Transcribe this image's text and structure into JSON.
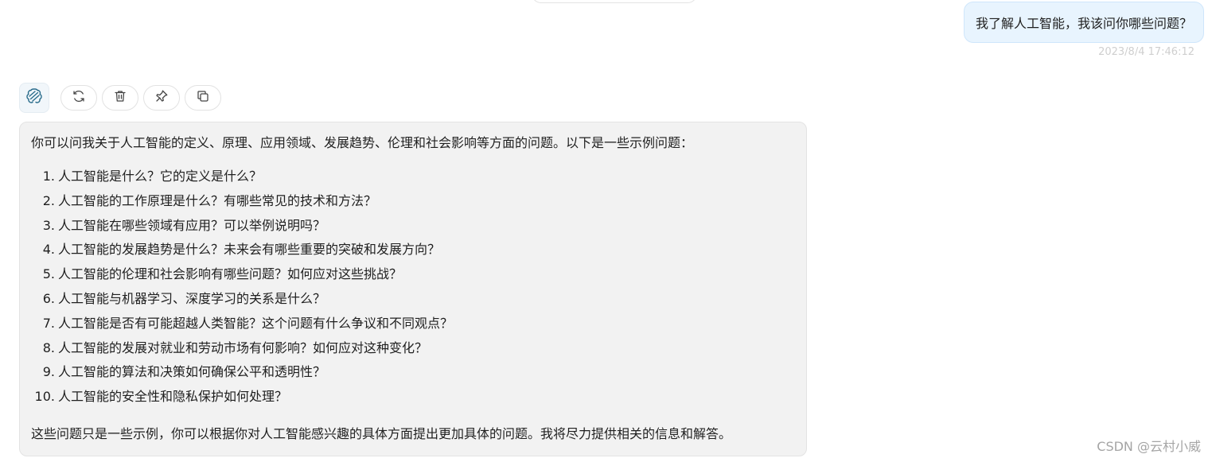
{
  "user_message": {
    "text": "我了解人工智能，我该问你哪些问题？",
    "timestamp": "2023/8/4 17:46:12"
  },
  "toolbar": {
    "icons": [
      "brain-avatar-icon",
      "refresh-icon",
      "delete-icon",
      "pin-icon",
      "copy-icon"
    ]
  },
  "bot_message": {
    "intro": "你可以问我关于人工智能的定义、原理、应用领域、发展趋势、伦理和社会影响等方面的问题。以下是一些示例问题：",
    "questions": [
      {
        "num": "1.",
        "text": "人工智能是什么？它的定义是什么？"
      },
      {
        "num": "2.",
        "text": "人工智能的工作原理是什么？有哪些常见的技术和方法？"
      },
      {
        "num": "3.",
        "text": "人工智能在哪些领域有应用？可以举例说明吗？"
      },
      {
        "num": "4.",
        "text": "人工智能的发展趋势是什么？未来会有哪些重要的突破和发展方向？"
      },
      {
        "num": "5.",
        "text": "人工智能的伦理和社会影响有哪些问题？如何应对这些挑战？"
      },
      {
        "num": "6.",
        "text": "人工智能与机器学习、深度学习的关系是什么？"
      },
      {
        "num": "7.",
        "text": "人工智能是否有可能超越人类智能？这个问题有什么争议和不同观点？"
      },
      {
        "num": "8.",
        "text": "人工智能的发展对就业和劳动市场有何影响？如何应对这种变化？"
      },
      {
        "num": "9.",
        "text": "人工智能的算法和决策如何确保公平和透明性？"
      },
      {
        "num": "10.",
        "text": "人工智能的安全性和隐私保护如何处理？"
      }
    ],
    "outro": "这些问题只是一些示例，你可以根据你对人工智能感兴趣的具体方面提出更加具体的问题。我将尽力提供相关的信息和解答。"
  },
  "watermark": "CSDN @云村小威",
  "colors": {
    "user_bubble_bg": "#e8f4fe",
    "bot_bubble_bg": "#f2f2f2",
    "timestamp": "#cfcfcf"
  }
}
